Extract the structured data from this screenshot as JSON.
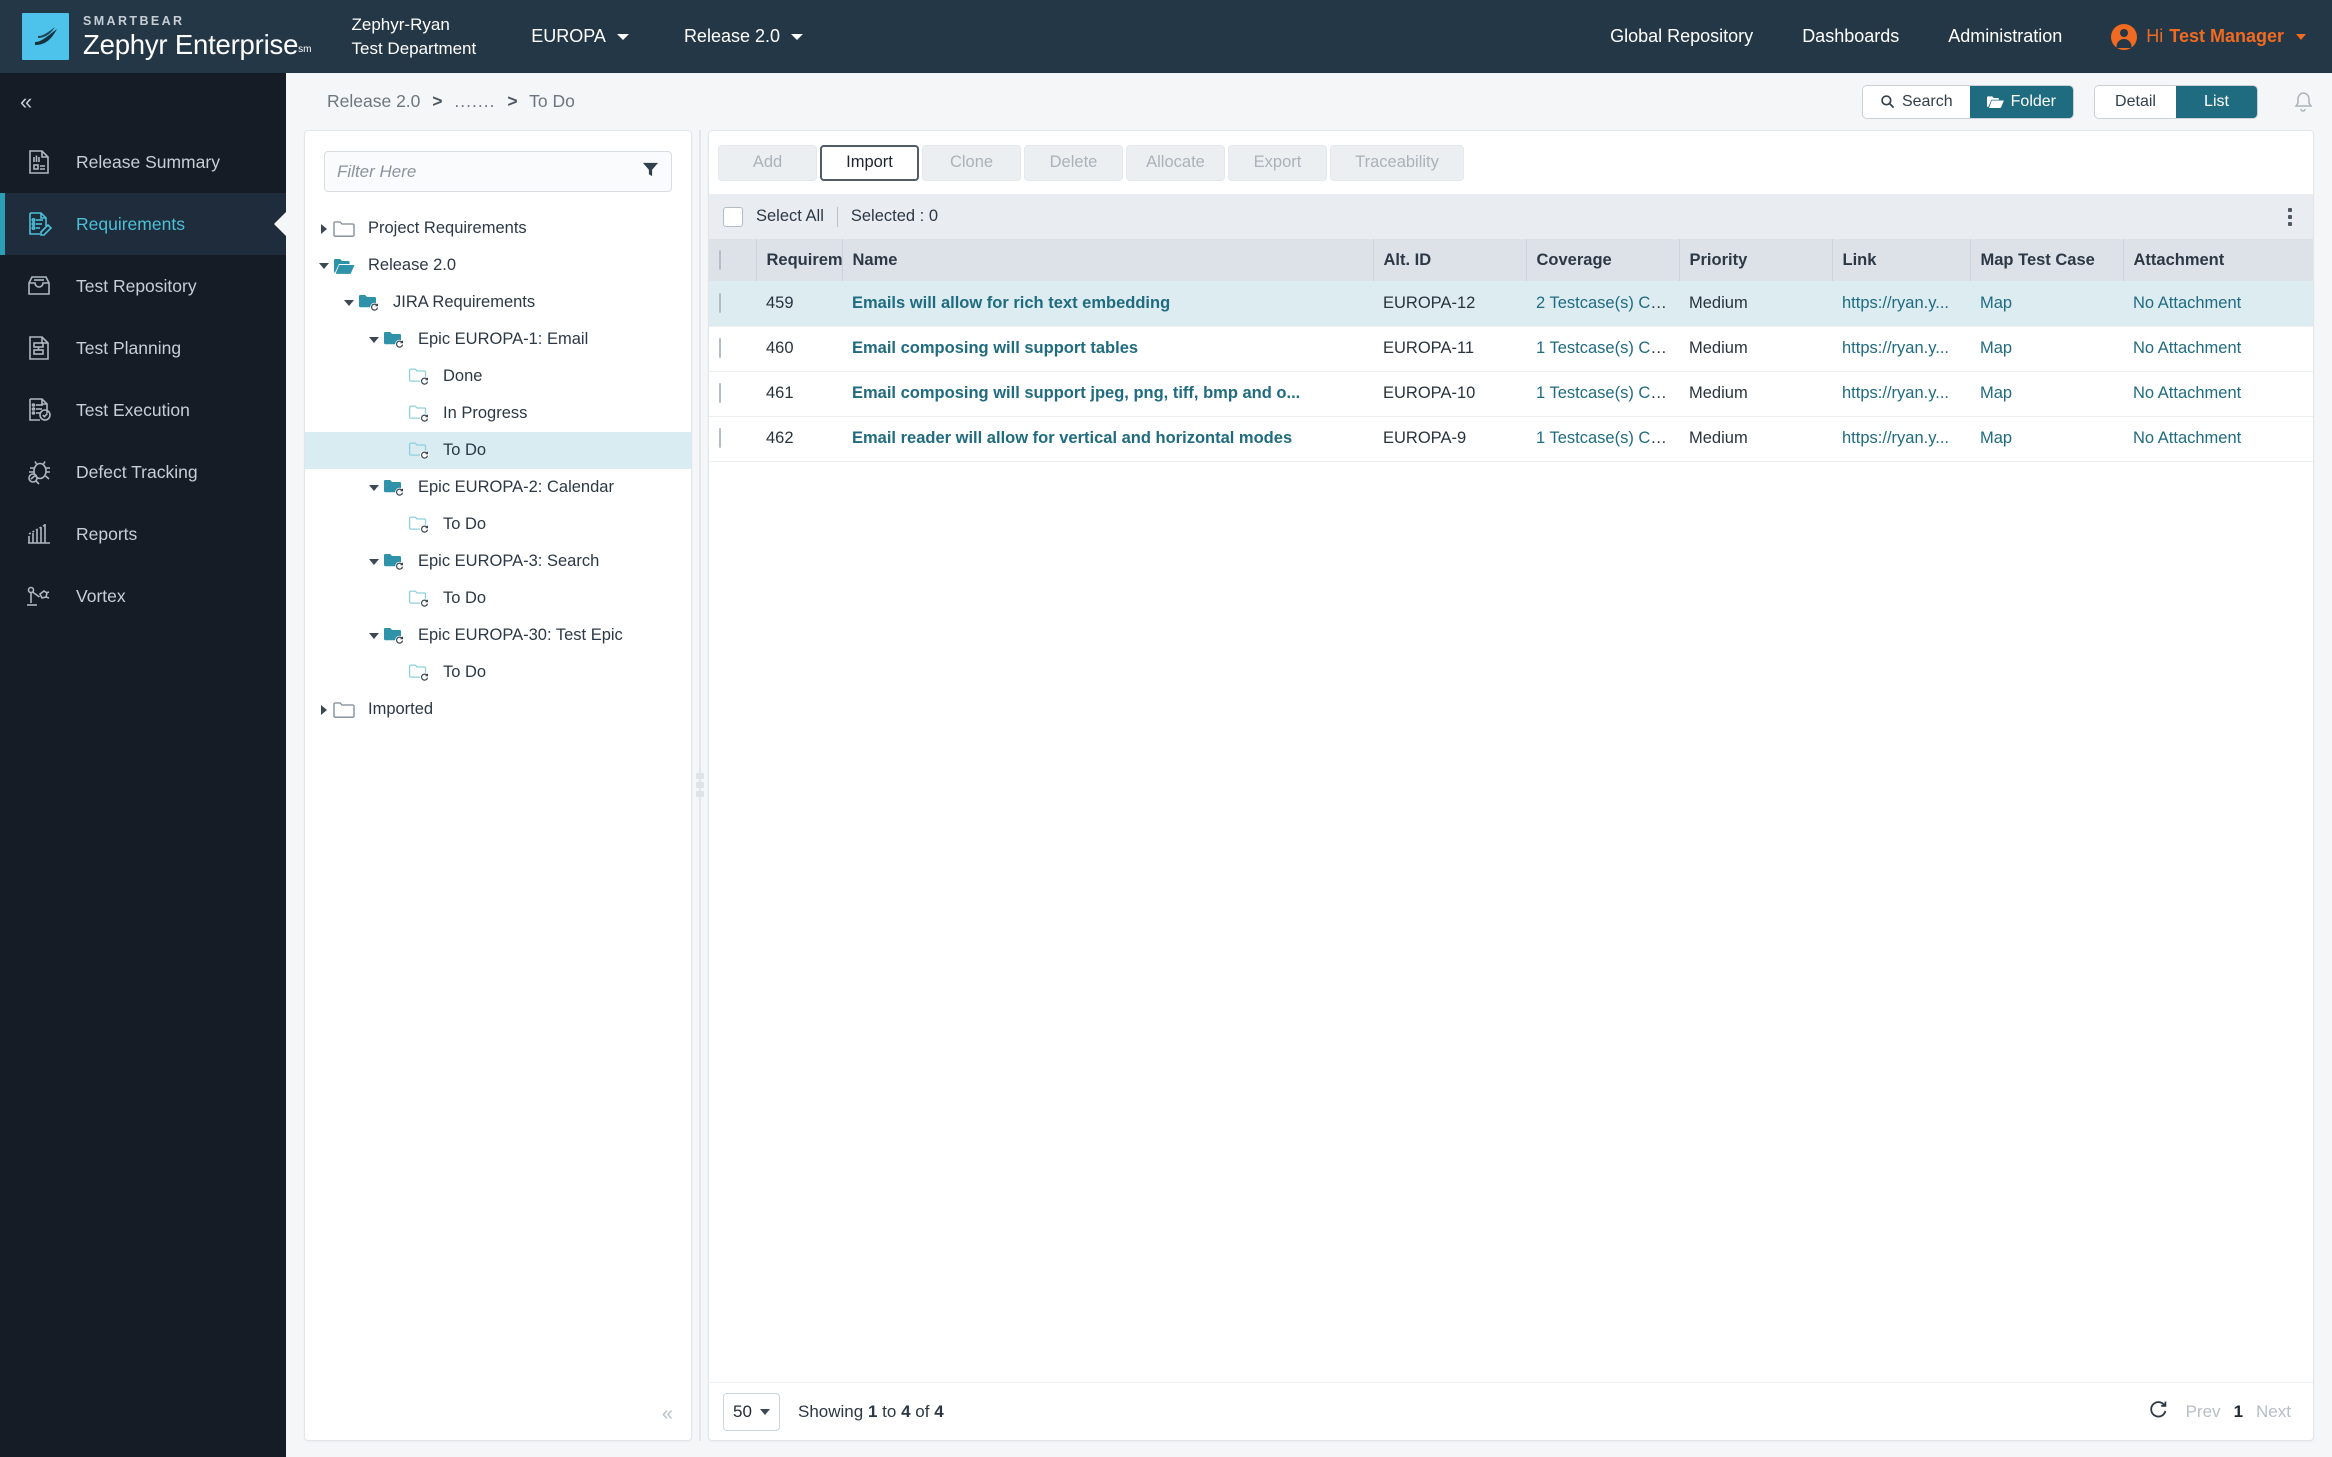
{
  "header": {
    "brand_small": "SMARTBEAR",
    "brand_main": "Zephyr Enterprise",
    "brand_sup": "sm",
    "dept_line1": "Zephyr-Ryan",
    "dept_line2": "Test Department",
    "project": "EUROPA",
    "release": "Release 2.0",
    "links": [
      "Global Repository",
      "Dashboards",
      "Administration"
    ],
    "greeting": "Hi",
    "username": "Test Manager",
    "accent_orange": "#f06a21",
    "bar_color": "#243746",
    "logo_tile_color": "#4dc3eb"
  },
  "sidebar": {
    "collapse_glyph": "«",
    "items": [
      {
        "label": "Release Summary",
        "icon": "release-summary-icon",
        "active": false
      },
      {
        "label": "Requirements",
        "icon": "requirements-icon",
        "active": true
      },
      {
        "label": "Test Repository",
        "icon": "test-repository-icon",
        "active": false
      },
      {
        "label": "Test Planning",
        "icon": "test-planning-icon",
        "active": false
      },
      {
        "label": "Test Execution",
        "icon": "test-execution-icon",
        "active": false
      },
      {
        "label": "Defect Tracking",
        "icon": "defect-tracking-icon",
        "active": false
      },
      {
        "label": "Reports",
        "icon": "reports-icon",
        "active": false
      },
      {
        "label": "Vortex",
        "icon": "vortex-icon",
        "active": false
      }
    ],
    "active_accent": "#2a9fb5",
    "active_text": "#4cc0d8"
  },
  "breadcrumb": {
    "root": "Release 2.0",
    "sep": ">",
    "ellipsis": ".......",
    "current": "To Do"
  },
  "viewbar": {
    "search_label": "Search",
    "folder_label": "Folder",
    "detail_label": "Detail",
    "list_label": "List",
    "active_mode": "Folder",
    "active_view": "List",
    "active_color": "#1f6b80",
    "bell_icon": "bell-icon"
  },
  "tree": {
    "filter_placeholder": "Filter Here",
    "filter_value": "",
    "filter_icon": "funnel-icon",
    "collapse_glyph": "«",
    "selected_node": "To Do",
    "nodes": [
      {
        "label": "Project Requirements",
        "depth": 0,
        "twisty": "right",
        "icon": "folder-plain-icon",
        "selected": false
      },
      {
        "label": "Release 2.0",
        "depth": 0,
        "twisty": "down",
        "icon": "folder-open-icon",
        "selected": false
      },
      {
        "label": "JIRA Requirements",
        "depth": 1,
        "twisty": "down",
        "icon": "folder-sync-icon",
        "selected": false
      },
      {
        "label": "Epic EUROPA-1: Email",
        "depth": 2,
        "twisty": "down",
        "icon": "folder-sync-icon",
        "selected": false
      },
      {
        "label": "Done",
        "depth": 3,
        "twisty": "none",
        "icon": "folder-leaf-icon",
        "selected": false
      },
      {
        "label": "In Progress",
        "depth": 3,
        "twisty": "none",
        "icon": "folder-leaf-icon",
        "selected": false
      },
      {
        "label": "To Do",
        "depth": 3,
        "twisty": "none",
        "icon": "folder-leaf-icon",
        "selected": true
      },
      {
        "label": "Epic EUROPA-2: Calendar",
        "depth": 2,
        "twisty": "down",
        "icon": "folder-sync-icon",
        "selected": false
      },
      {
        "label": "To Do",
        "depth": 3,
        "twisty": "none",
        "icon": "folder-leaf-icon",
        "selected": false
      },
      {
        "label": "Epic EUROPA-3: Search",
        "depth": 2,
        "twisty": "down",
        "icon": "folder-sync-icon",
        "selected": false
      },
      {
        "label": "To Do",
        "depth": 3,
        "twisty": "none",
        "icon": "folder-leaf-icon",
        "selected": false
      },
      {
        "label": "Epic EUROPA-30: Test Epic",
        "depth": 2,
        "twisty": "down",
        "icon": "folder-sync-icon",
        "selected": false
      },
      {
        "label": "To Do",
        "depth": 3,
        "twisty": "none",
        "icon": "folder-leaf-icon",
        "selected": false
      },
      {
        "label": "Imported",
        "depth": 0,
        "twisty": "right",
        "icon": "folder-plain-icon",
        "selected": false
      }
    ]
  },
  "actions": [
    {
      "label": "Add",
      "enabled": false
    },
    {
      "label": "Import",
      "enabled": true
    },
    {
      "label": "Clone",
      "enabled": false
    },
    {
      "label": "Delete",
      "enabled": false
    },
    {
      "label": "Allocate",
      "enabled": false
    },
    {
      "label": "Export",
      "enabled": false
    },
    {
      "label": "Traceability",
      "enabled": false
    }
  ],
  "selection_bar": {
    "select_all_label": "Select All",
    "selected_label": "Selected : 0",
    "kebab_icon": "more-vertical-icon"
  },
  "table": {
    "columns": [
      "Requirement",
      "Name",
      "Alt. ID",
      "Coverage",
      "Priority",
      "Link",
      "Map Test Case",
      "Attachment"
    ],
    "rows": [
      {
        "id": "459",
        "name": "Emails will allow for rich text embedding",
        "alt_id": "EUROPA-12",
        "coverage": "2 Testcase(s) Co...",
        "priority": "Medium",
        "link": "https://ryan.y...",
        "map": "Map",
        "attachment": "No Attachment",
        "highlighted": true
      },
      {
        "id": "460",
        "name": "Email composing will support tables",
        "alt_id": "EUROPA-11",
        "coverage": "1 Testcase(s) Co...",
        "priority": "Medium",
        "link": "https://ryan.y...",
        "map": "Map",
        "attachment": "No Attachment",
        "highlighted": false
      },
      {
        "id": "461",
        "name": "Email composing will support jpeg, png, tiff, bmp and o...",
        "alt_id": "EUROPA-10",
        "coverage": "1 Testcase(s) Co...",
        "priority": "Medium",
        "link": "https://ryan.y...",
        "map": "Map",
        "attachment": "No Attachment",
        "highlighted": false
      },
      {
        "id": "462",
        "name": "Email reader will allow for vertical and horizontal modes",
        "alt_id": "EUROPA-9",
        "coverage": "1 Testcase(s) Co...",
        "priority": "Medium",
        "link": "https://ryan.y...",
        "map": "Map",
        "attachment": "No Attachment",
        "highlighted": false
      }
    ]
  },
  "footer": {
    "page_size": "50",
    "showing_prefix": "Showing",
    "showing_from": "1",
    "showing_to_word": "to",
    "showing_to": "4",
    "showing_of_word": "of",
    "showing_total": "4",
    "refresh_icon": "refresh-icon",
    "prev_label": "Prev",
    "page_number": "1",
    "next_label": "Next"
  }
}
